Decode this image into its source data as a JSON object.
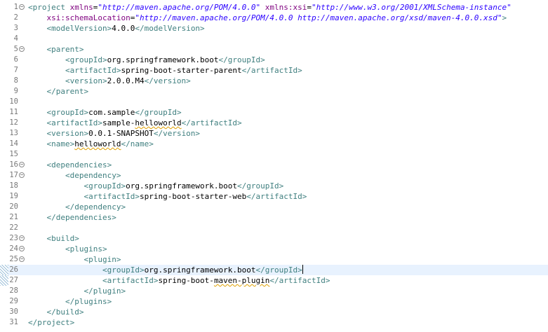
{
  "editor": {
    "current_line": 26,
    "lines": [
      {
        "n": "1",
        "fold": true,
        "tokens": [
          {
            "c": "t",
            "s": "<project "
          },
          {
            "c": "a",
            "s": "xmlns"
          },
          {
            "c": "x",
            "s": "="
          },
          {
            "c": "v",
            "s": "\"http://maven.apache.org/POM/4.0.0\""
          },
          {
            "c": "x",
            "s": " "
          },
          {
            "c": "a",
            "s": "xmlns:xsi"
          },
          {
            "c": "x",
            "s": "="
          },
          {
            "c": "v",
            "s": "\"http://www.w3.org/2001/XMLSchema-instance\""
          }
        ]
      },
      {
        "n": "2",
        "tokens": [
          {
            "c": "x",
            "s": "    "
          },
          {
            "c": "a",
            "s": "xsi:schemaLocation"
          },
          {
            "c": "x",
            "s": "="
          },
          {
            "c": "v",
            "s": "\"http://maven.apache.org/POM/4.0.0 http://maven.apache.org/xsd/maven-4.0.0.xsd\""
          },
          {
            "c": "t",
            "s": ">"
          }
        ]
      },
      {
        "n": "3",
        "tokens": [
          {
            "c": "x",
            "s": "    "
          },
          {
            "c": "t",
            "s": "<modelVersion>"
          },
          {
            "c": "x",
            "s": "4.0.0"
          },
          {
            "c": "t",
            "s": "</modelVersion>"
          }
        ]
      },
      {
        "n": "4",
        "tokens": []
      },
      {
        "n": "5",
        "fold": true,
        "tokens": [
          {
            "c": "x",
            "s": "    "
          },
          {
            "c": "t",
            "s": "<parent>"
          }
        ]
      },
      {
        "n": "6",
        "tokens": [
          {
            "c": "x",
            "s": "        "
          },
          {
            "c": "t",
            "s": "<groupId>"
          },
          {
            "c": "x",
            "s": "org.springframework.boot"
          },
          {
            "c": "t",
            "s": "</groupId>"
          }
        ]
      },
      {
        "n": "7",
        "tokens": [
          {
            "c": "x",
            "s": "        "
          },
          {
            "c": "t",
            "s": "<artifactId>"
          },
          {
            "c": "x",
            "s": "spring-boot-starter-parent"
          },
          {
            "c": "t",
            "s": "</artifactId>"
          }
        ]
      },
      {
        "n": "8",
        "tokens": [
          {
            "c": "x",
            "s": "        "
          },
          {
            "c": "t",
            "s": "<version>"
          },
          {
            "c": "x",
            "s": "2.0.0.M4"
          },
          {
            "c": "t",
            "s": "</version>"
          }
        ]
      },
      {
        "n": "9",
        "tokens": [
          {
            "c": "x",
            "s": "    "
          },
          {
            "c": "t",
            "s": "</parent>"
          }
        ]
      },
      {
        "n": "10",
        "tokens": []
      },
      {
        "n": "11",
        "tokens": [
          {
            "c": "x",
            "s": "    "
          },
          {
            "c": "t",
            "s": "<groupId>"
          },
          {
            "c": "x",
            "s": "com.sample"
          },
          {
            "c": "t",
            "s": "</groupId>"
          }
        ]
      },
      {
        "n": "12",
        "tokens": [
          {
            "c": "x",
            "s": "    "
          },
          {
            "c": "t",
            "s": "<artifactId>"
          },
          {
            "c": "x",
            "s": "sample-"
          },
          {
            "c": "x sq",
            "s": "helloworld"
          },
          {
            "c": "t",
            "s": "</artifactId>"
          }
        ]
      },
      {
        "n": "13",
        "tokens": [
          {
            "c": "x",
            "s": "    "
          },
          {
            "c": "t",
            "s": "<version>"
          },
          {
            "c": "x",
            "s": "0.0.1-SNAPSHOT"
          },
          {
            "c": "t",
            "s": "</version>"
          }
        ]
      },
      {
        "n": "14",
        "tokens": [
          {
            "c": "x",
            "s": "    "
          },
          {
            "c": "t",
            "s": "<name>"
          },
          {
            "c": "x sq",
            "s": "helloworld"
          },
          {
            "c": "t",
            "s": "</name>"
          }
        ]
      },
      {
        "n": "15",
        "tokens": []
      },
      {
        "n": "16",
        "fold": true,
        "tokens": [
          {
            "c": "x",
            "s": "    "
          },
          {
            "c": "t",
            "s": "<dependencies>"
          }
        ]
      },
      {
        "n": "17",
        "fold": true,
        "tokens": [
          {
            "c": "x",
            "s": "        "
          },
          {
            "c": "t",
            "s": "<dependency>"
          }
        ]
      },
      {
        "n": "18",
        "tokens": [
          {
            "c": "x",
            "s": "            "
          },
          {
            "c": "t",
            "s": "<groupId>"
          },
          {
            "c": "x",
            "s": "org.springframework.boot"
          },
          {
            "c": "t",
            "s": "</groupId>"
          }
        ]
      },
      {
        "n": "19",
        "tokens": [
          {
            "c": "x",
            "s": "            "
          },
          {
            "c": "t",
            "s": "<artifactId>"
          },
          {
            "c": "x",
            "s": "spring-boot-starter-web"
          },
          {
            "c": "t",
            "s": "</artifactId>"
          }
        ]
      },
      {
        "n": "20",
        "tokens": [
          {
            "c": "x",
            "s": "        "
          },
          {
            "c": "t",
            "s": "</dependency>"
          }
        ]
      },
      {
        "n": "21",
        "tokens": [
          {
            "c": "x",
            "s": "    "
          },
          {
            "c": "t",
            "s": "</dependencies>"
          }
        ]
      },
      {
        "n": "22",
        "tokens": []
      },
      {
        "n": "23",
        "fold": true,
        "tokens": [
          {
            "c": "x",
            "s": "    "
          },
          {
            "c": "t",
            "s": "<build>"
          }
        ]
      },
      {
        "n": "24",
        "fold": true,
        "tokens": [
          {
            "c": "x",
            "s": "        "
          },
          {
            "c": "t",
            "s": "<plugins>"
          }
        ]
      },
      {
        "n": "25",
        "fold": true,
        "tokens": [
          {
            "c": "x",
            "s": "            "
          },
          {
            "c": "t",
            "s": "<plugin>"
          }
        ]
      },
      {
        "n": "26",
        "marker": true,
        "caret_after": 3,
        "tokens": [
          {
            "c": "x",
            "s": "                "
          },
          {
            "c": "t",
            "s": "<groupId>"
          },
          {
            "c": "x",
            "s": "org.springframework.boot"
          },
          {
            "c": "t",
            "s": "</groupId>"
          }
        ]
      },
      {
        "n": "27",
        "marker": true,
        "tokens": [
          {
            "c": "x",
            "s": "                "
          },
          {
            "c": "t",
            "s": "<artifactId>"
          },
          {
            "c": "x",
            "s": "spring-boot-"
          },
          {
            "c": "x sq",
            "s": "maven-plugin"
          },
          {
            "c": "t",
            "s": "</artifactId>"
          }
        ]
      },
      {
        "n": "28",
        "tokens": [
          {
            "c": "x",
            "s": "            "
          },
          {
            "c": "t",
            "s": "</plugin>"
          }
        ]
      },
      {
        "n": "29",
        "tokens": [
          {
            "c": "x",
            "s": "        "
          },
          {
            "c": "t",
            "s": "</plugins>"
          }
        ]
      },
      {
        "n": "30",
        "tokens": [
          {
            "c": "x",
            "s": "    "
          },
          {
            "c": "t",
            "s": "</build>"
          }
        ]
      },
      {
        "n": "31",
        "tokens": [
          {
            "c": "t",
            "s": "</project>"
          }
        ]
      }
    ]
  }
}
